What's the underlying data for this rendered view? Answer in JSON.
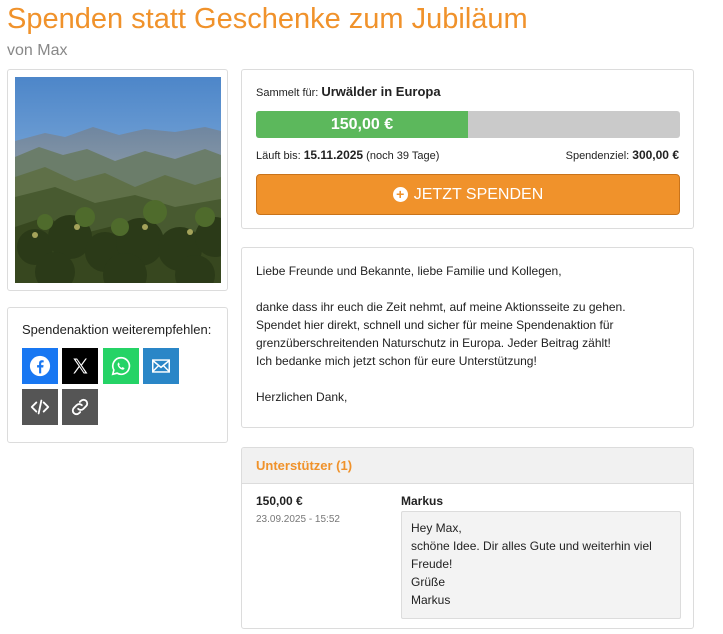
{
  "page": {
    "title": "Spenden statt Geschenke zum Jubiläum",
    "byline": "von Max"
  },
  "share": {
    "label": "Spendenaktion weiterempfehlen:",
    "buttons": [
      {
        "icon": "facebook-icon"
      },
      {
        "icon": "x-icon"
      },
      {
        "icon": "whatsapp-icon"
      },
      {
        "icon": "mail-icon"
      },
      {
        "icon": "embed-code-icon"
      },
      {
        "icon": "link-icon"
      }
    ]
  },
  "donation": {
    "collects_label": "Sammelt für:",
    "collects_for": "Urwälder in Europa",
    "raised": "150,00 €",
    "progress_fraction": 0.5,
    "runs_label": "Läuft bis:",
    "end_date": "15.11.2025",
    "days_left": "(noch 39 Tage)",
    "goal_label": "Spendenziel:",
    "goal": "300,00 €",
    "button_label": "JETZT SPENDEN",
    "colors": {
      "accent": "#f0922b",
      "progress": "#5cb85c",
      "track": "#cacaca"
    }
  },
  "message": {
    "paragraphs": [
      [
        "Liebe Freunde und Bekannte, liebe Familie und Kollegen,"
      ],
      [
        "danke dass ihr euch die Zeit nehmt, auf meine Aktionsseite zu gehen.",
        "Spendet hier direkt, schnell und sicher für meine Spendenaktion für",
        "grenzüberschreitenden Naturschutz in Europa. Jeder Beitrag zählt!",
        "Ich bedanke mich jetzt schon für eure Unterstützung!"
      ],
      [
        "Herzlichen Dank,"
      ]
    ]
  },
  "supporters": {
    "title": "Unterstützer (1)",
    "items": [
      {
        "amount": "150,00 €",
        "date": "23.09.2025 - 15:52",
        "name": "Markus",
        "comment": [
          "Hey Max,",
          "schöne Idee. Dir alles Gute und weiterhin viel",
          "Freude!",
          "Grüße",
          "Markus"
        ]
      }
    ]
  }
}
